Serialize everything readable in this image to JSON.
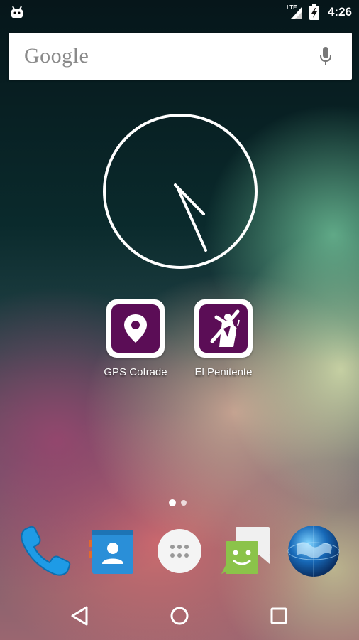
{
  "statusbar": {
    "network_label": "LTE",
    "time": "4:26"
  },
  "search": {
    "logo_text": "Google"
  },
  "clock_widget": {
    "time": "4:26"
  },
  "apps": [
    {
      "label": "GPS Cofrade",
      "icon": "map-pin-icon"
    },
    {
      "label": "El Penitente",
      "icon": "penitent-figure-icon"
    }
  ],
  "page_indicator": {
    "pages": 2,
    "current": 1
  },
  "dock": [
    {
      "icon": "phone-icon"
    },
    {
      "icon": "contacts-icon"
    },
    {
      "icon": "app-drawer-icon"
    },
    {
      "icon": "messaging-icon"
    },
    {
      "icon": "browser-globe-icon"
    }
  ],
  "navbar": {
    "buttons": [
      "back-icon",
      "home-icon",
      "recents-icon"
    ]
  },
  "colors": {
    "app_icon_purple": "#5b0d56",
    "phone_blue": "#1e9be6",
    "message_green": "#8bc34a"
  }
}
